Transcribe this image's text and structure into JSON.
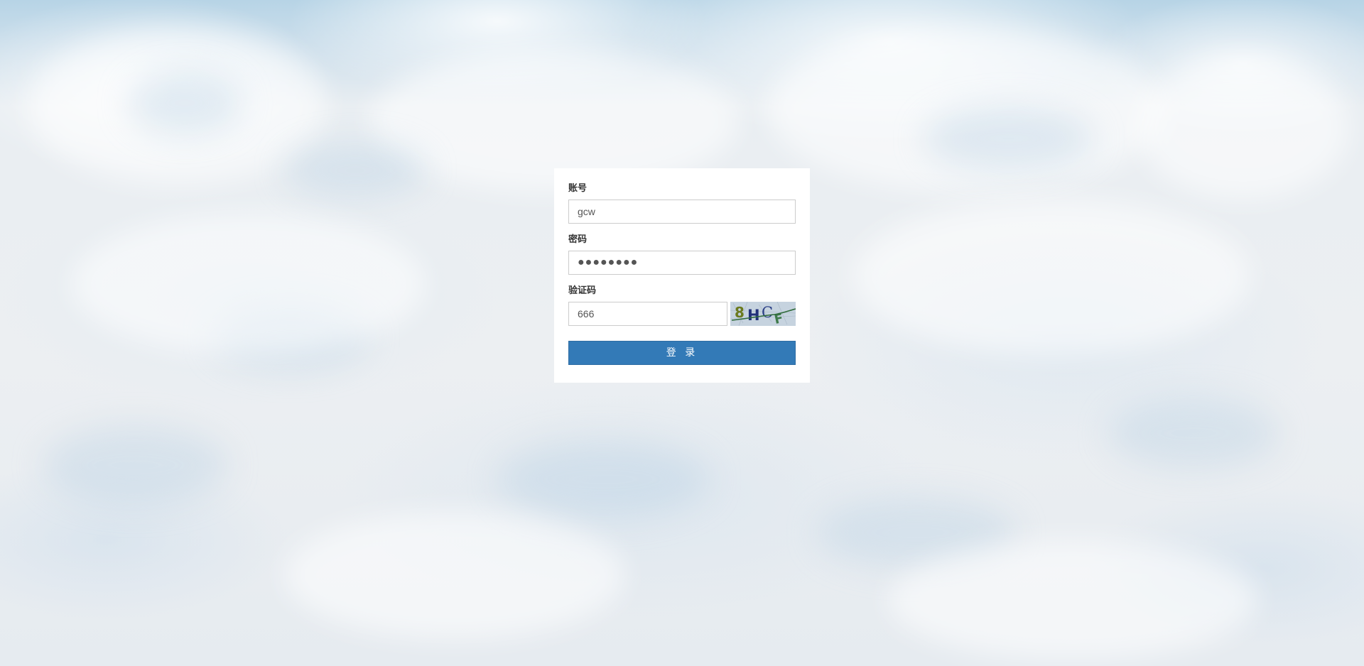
{
  "login": {
    "account_label": "账号",
    "account_value": "gcw",
    "password_label": "密码",
    "password_value": "●●●●●●●●",
    "captcha_label": "验证码",
    "captcha_value": "666",
    "captcha_image_text": "8HCF",
    "submit_label": "登 录"
  },
  "colors": {
    "button": "#337ab7",
    "panel": "#ffffff",
    "sky": "#b7d4e6"
  }
}
